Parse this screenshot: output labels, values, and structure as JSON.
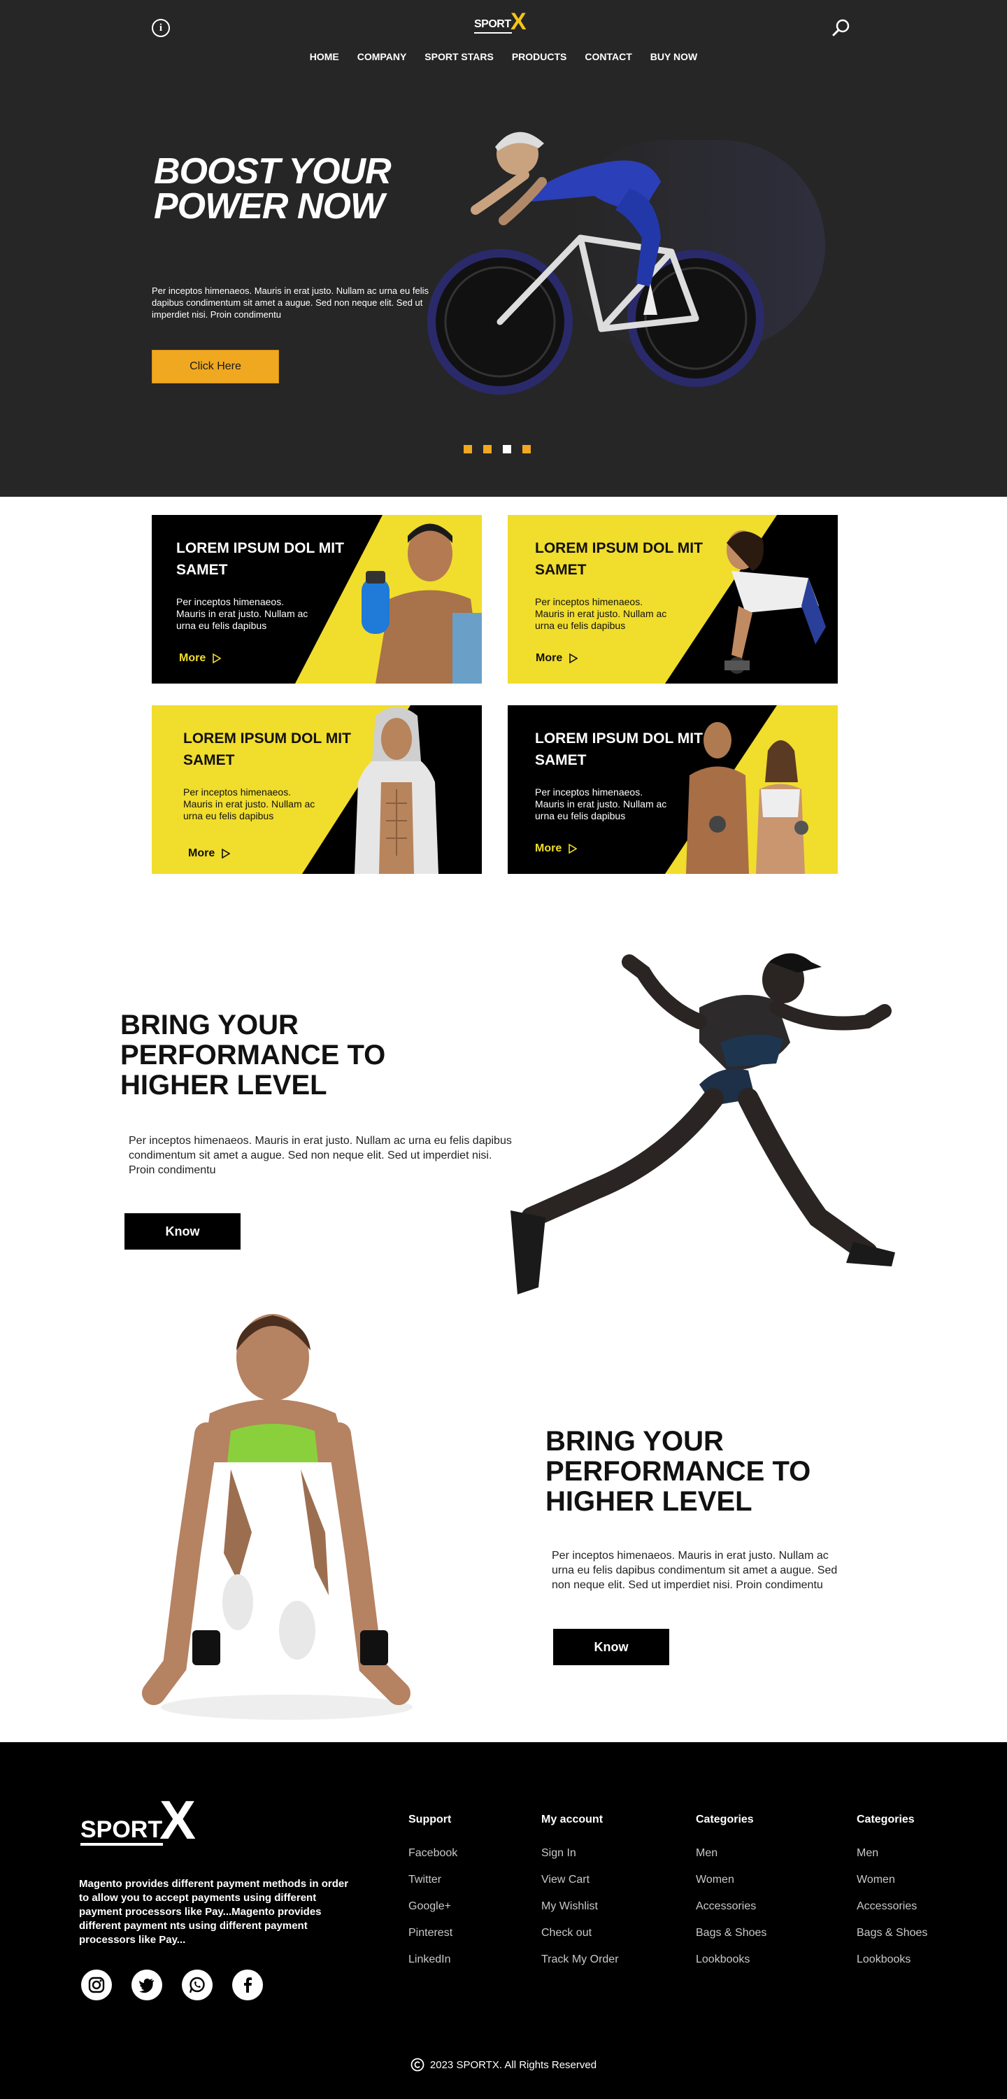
{
  "header": {
    "logo_text": "SPORT",
    "logo_x": "X",
    "nav": [
      "HOME",
      "COMPANY",
      "SPORT STARS",
      "PRODUCTS",
      "CONTACT",
      "BUY NOW"
    ]
  },
  "hero": {
    "title": "BOOST YOUR POWER NOW",
    "text": "Per inceptos himenaeos. Mauris in erat justo. Nullam ac urna eu felis dapibus condimentum sit amet a augue. Sed non neque elit. Sed ut imperdiet nisi. Proin condimentu",
    "button": "Click Here",
    "slide_count": 4,
    "active_slide": 3
  },
  "cards": [
    {
      "title": "LOREM IPSUM DOL MIT SAMET",
      "desc": "Per inceptos himenaeos. Mauris in erat justo. Nullam ac urna eu felis dapibus",
      "more": "More"
    },
    {
      "title": "LOREM IPSUM DOL MIT SAMET",
      "desc": "Per inceptos himenaeos. Mauris in erat justo. Nullam ac urna eu felis dapibus",
      "more": "More"
    },
    {
      "title": "LOREM IPSUM DOL MIT SAMET",
      "desc": "Per inceptos himenaeos. Mauris in erat justo. Nullam ac urna eu felis dapibus",
      "more": "More"
    },
    {
      "title": "LOREM IPSUM DOL MIT SAMET",
      "desc": "Per inceptos himenaeos. Mauris in erat justo. Nullam ac urna eu felis dapibus",
      "more": "More"
    }
  ],
  "features": [
    {
      "title": "BRING YOUR PERFORMANCE TO HIGHER LEVEL",
      "text": "Per inceptos himenaeos. Mauris in erat justo. Nullam ac urna eu felis dapibus condimentum sit amet a augue. Sed non neque elit. Sed ut imperdiet nisi. Proin condimentu",
      "button": "Know"
    },
    {
      "title": "BRING YOUR PERFORMANCE TO HIGHER LEVEL",
      "text": "Per inceptos himenaeos. Mauris in erat justo. Nullam ac urna eu felis dapibus condimentum sit amet a augue. Sed non neque elit. Sed ut imperdiet nisi. Proin condimentu",
      "button": "Know"
    }
  ],
  "footer": {
    "about": "Magento provides different payment methods in order to allow you to accept payments using different payment processors like Pay...Magento provides different payment nts using different payment processors like Pay...",
    "socials": [
      "instagram-icon",
      "twitter-icon",
      "whatsapp-icon",
      "facebook-icon"
    ],
    "columns": [
      {
        "title": "Support",
        "links": [
          "Facebook",
          "Twitter",
          "Google+",
          "Pinterest",
          "LinkedIn"
        ]
      },
      {
        "title": "My account",
        "links": [
          "Sign In",
          "View Cart",
          "My Wishlist",
          "Check out",
          "Track My Order"
        ]
      },
      {
        "title": "Categories",
        "links": [
          "Men",
          "Women",
          "Accessories",
          "Bags & Shoes",
          "Lookbooks"
        ]
      },
      {
        "title": "Categories",
        "links": [
          "Men",
          "Women",
          "Accessories",
          "Bags & Shoes",
          "Lookbooks"
        ]
      }
    ],
    "copyright": "2023 SPORTX. All Rights Reserved"
  },
  "colors": {
    "accent": "#f0a820",
    "card_yellow": "#f1dd2c",
    "dark": "#262626",
    "black": "#000000"
  }
}
